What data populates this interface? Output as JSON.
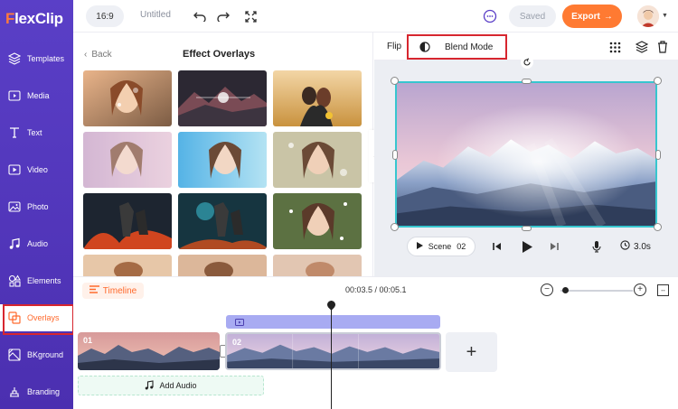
{
  "app": {
    "logo_first": "F",
    "logo_rest": "lexClip"
  },
  "sidebar": {
    "items": [
      {
        "label": "Templates",
        "icon": "layers-icon"
      },
      {
        "label": "Media",
        "icon": "media-icon"
      },
      {
        "label": "Text",
        "icon": "text-icon"
      },
      {
        "label": "Video",
        "icon": "video-icon"
      },
      {
        "label": "Photo",
        "icon": "photo-icon"
      },
      {
        "label": "Audio",
        "icon": "music-icon"
      },
      {
        "label": "Elements",
        "icon": "elements-icon"
      },
      {
        "label": "Overlays",
        "icon": "overlays-icon",
        "active": true
      },
      {
        "label": "BKground",
        "icon": "background-icon"
      },
      {
        "label": "Branding",
        "icon": "branding-icon"
      }
    ]
  },
  "topbar": {
    "ratio": "16:9",
    "title": "Untitled",
    "saved": "Saved",
    "export": "Export",
    "export_arrow": "→"
  },
  "panel": {
    "back": "Back",
    "title": "Effect Overlays"
  },
  "preview": {
    "flip": "Flip",
    "blend_mode": "Blend Mode",
    "scene_label": "Scene",
    "scene_number": "02",
    "duration": "3.0s"
  },
  "timeline": {
    "label": "Timeline",
    "time": "00:03.5 / 00:05.1",
    "zoom_out": "−",
    "zoom_in": "+",
    "clips": [
      {
        "number": "01"
      },
      {
        "number": "02"
      }
    ],
    "add_scene": "+",
    "add_audio": "Add Audio"
  },
  "colors": {
    "sidebar": "#5a3fc7",
    "accent": "#ff7a32",
    "highlight": "#d7262f",
    "selection": "#37c6cf",
    "overlay_track": "#a8abf2"
  }
}
